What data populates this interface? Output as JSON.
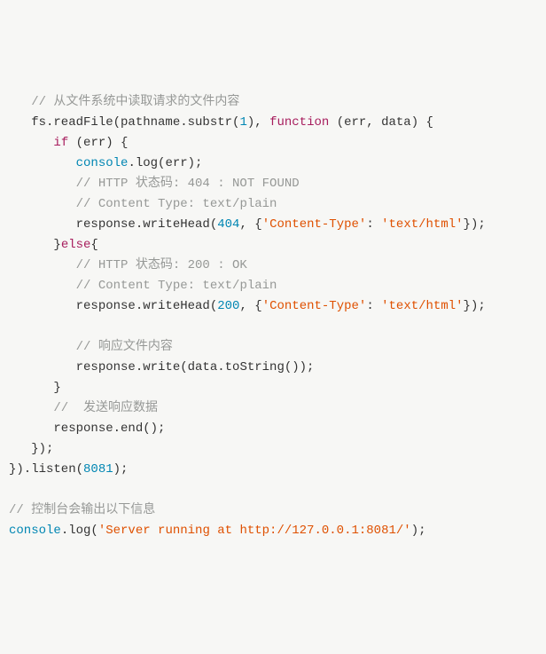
{
  "code": {
    "l01": {
      "cm": "// 从文件系统中读取请求的文件内容"
    },
    "l02": {
      "a": "   fs.readFile(pathname.substr(",
      "n": "1",
      "b": "), ",
      "kw": "function",
      "c": " (err, data) {"
    },
    "l03": {
      "a": "      ",
      "kw": "if",
      "b": " (err) {"
    },
    "l04": {
      "a": "         ",
      "fn": "console",
      "b": ".log(err);"
    },
    "l05": {
      "cm": "         // HTTP 状态码: 404 : NOT FOUND"
    },
    "l06": {
      "cm": "         // Content Type: text/plain"
    },
    "l07": {
      "a": "         response.writeHead(",
      "n": "404",
      "b": ", {",
      "s1": "'Content-Type'",
      "c": ": ",
      "s2": "'text/html'",
      "d": "});"
    },
    "l08": {
      "a": "      }",
      "kw": "else",
      "b": "{"
    },
    "l09": {
      "cm": "         // HTTP 状态码: 200 : OK"
    },
    "l10": {
      "cm": "         // Content Type: text/plain"
    },
    "l11": {
      "a": "         response.writeHead(",
      "n": "200",
      "b": ", {",
      "s1": "'Content-Type'",
      "c": ": ",
      "s2": "'text/html'",
      "d": "});"
    },
    "l12": {
      "blank": " "
    },
    "l13": {
      "cm": "         // 响应文件内容"
    },
    "l14": {
      "a": "         response.write(data.toString());"
    },
    "l15": {
      "a": "      }"
    },
    "l16": {
      "cm": "      //  发送响应数据"
    },
    "l17": {
      "a": "      response.end();"
    },
    "l18": {
      "a": "   });"
    },
    "l19": {
      "a": "}).listen(",
      "n": "8081",
      "b": ");"
    },
    "l20": {
      "blank": " "
    },
    "l21": {
      "cm": "// 控制台会输出以下信息"
    },
    "l22": {
      "fn": "console",
      "a": ".log(",
      "s1": "'Server running at http://127.0.0.1:8081/'",
      "b": ");"
    }
  }
}
